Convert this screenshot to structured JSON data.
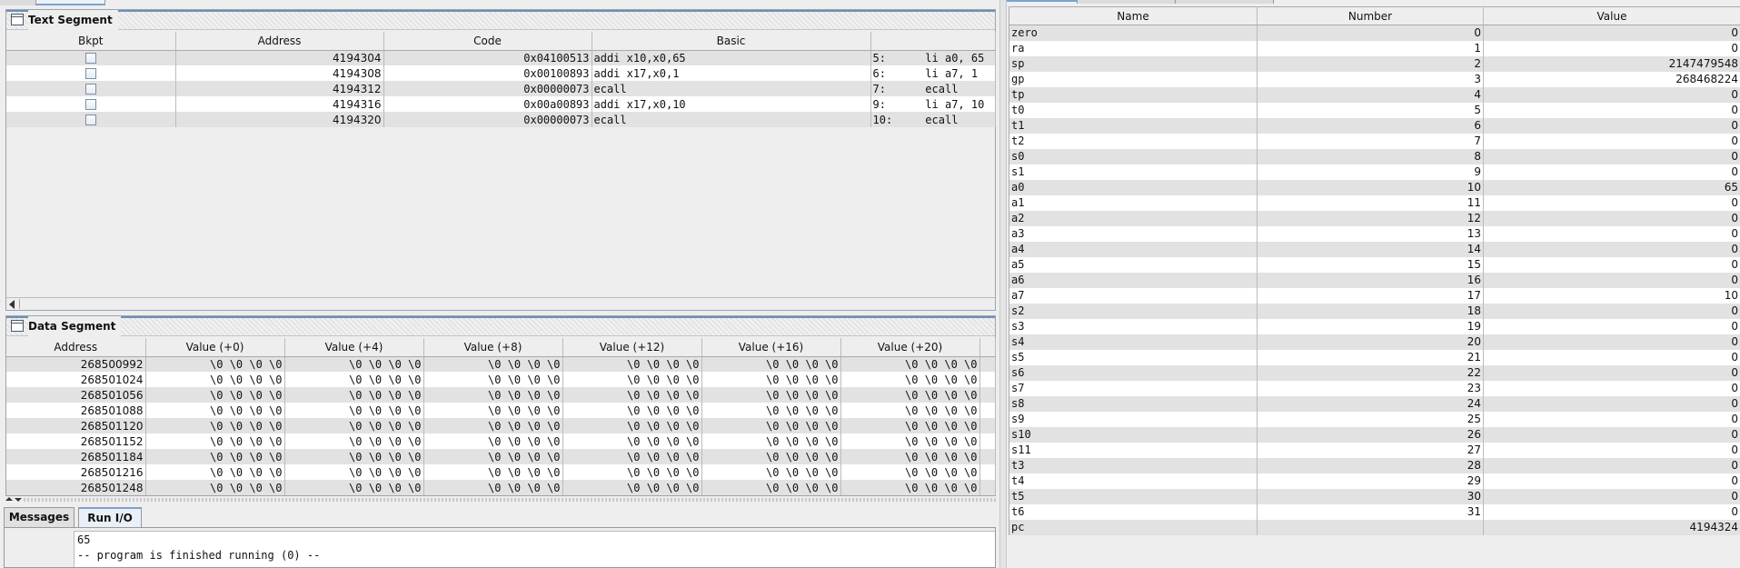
{
  "text_segment": {
    "title": "Text Segment",
    "columns": [
      "Bkpt",
      "Address",
      "Code",
      "Basic",
      ""
    ],
    "rows": [
      {
        "address": "4194304",
        "code": "0x04100513",
        "basic": "addi x10,x0,65",
        "source": "5:      li a0, 65"
      },
      {
        "address": "4194308",
        "code": "0x00100893",
        "basic": "addi x17,x0,1",
        "source": "6:      li a7, 1"
      },
      {
        "address": "4194312",
        "code": "0x00000073",
        "basic": "ecall",
        "source": "7:      ecall"
      },
      {
        "address": "4194316",
        "code": "0x00a00893",
        "basic": "addi x17,x0,10",
        "source": "9:      li a7, 10"
      },
      {
        "address": "4194320",
        "code": "0x00000073",
        "basic": "ecall",
        "source": "10:     ecall"
      }
    ]
  },
  "data_segment": {
    "title": "Data Segment",
    "columns": [
      "Address",
      "Value (+0)",
      "Value (+4)",
      "Value (+8)",
      "Value (+12)",
      "Value (+16)",
      "Value (+20)"
    ],
    "cell_value": "\\0 \\0 \\0 \\0",
    "rows": [
      {
        "address": "268500992",
        "values": [
          "\\0 \\0 \\0 \\0",
          "\\0 \\0 \\0 \\0",
          "\\0 \\0 \\0 \\0",
          "\\0 \\0 \\0 \\0",
          "\\0 \\0 \\0 \\0",
          "\\0 \\0 \\0 \\0"
        ]
      },
      {
        "address": "268501024",
        "values": [
          "\\0 \\0 \\0 \\0",
          "\\0 \\0 \\0 \\0",
          "\\0 \\0 \\0 \\0",
          "\\0 \\0 \\0 \\0",
          "\\0 \\0 \\0 \\0",
          "\\0 \\0 \\0 \\0"
        ]
      },
      {
        "address": "268501056",
        "values": [
          "\\0 \\0 \\0 \\0",
          "\\0 \\0 \\0 \\0",
          "\\0 \\0 \\0 \\0",
          "\\0 \\0 \\0 \\0",
          "\\0 \\0 \\0 \\0",
          "\\0 \\0 \\0 \\0"
        ]
      },
      {
        "address": "268501088",
        "values": [
          "\\0 \\0 \\0 \\0",
          "\\0 \\0 \\0 \\0",
          "\\0 \\0 \\0 \\0",
          "\\0 \\0 \\0 \\0",
          "\\0 \\0 \\0 \\0",
          "\\0 \\0 \\0 \\0"
        ]
      },
      {
        "address": "268501120",
        "values": [
          "\\0 \\0 \\0 \\0",
          "\\0 \\0 \\0 \\0",
          "\\0 \\0 \\0 \\0",
          "\\0 \\0 \\0 \\0",
          "\\0 \\0 \\0 \\0",
          "\\0 \\0 \\0 \\0"
        ]
      },
      {
        "address": "268501152",
        "values": [
          "\\0 \\0 \\0 \\0",
          "\\0 \\0 \\0 \\0",
          "\\0 \\0 \\0 \\0",
          "\\0 \\0 \\0 \\0",
          "\\0 \\0 \\0 \\0",
          "\\0 \\0 \\0 \\0"
        ]
      },
      {
        "address": "268501184",
        "values": [
          "\\0 \\0 \\0 \\0",
          "\\0 \\0 \\0 \\0",
          "\\0 \\0 \\0 \\0",
          "\\0 \\0 \\0 \\0",
          "\\0 \\0 \\0 \\0",
          "\\0 \\0 \\0 \\0"
        ]
      },
      {
        "address": "268501216",
        "values": [
          "\\0 \\0 \\0 \\0",
          "\\0 \\0 \\0 \\0",
          "\\0 \\0 \\0 \\0",
          "\\0 \\0 \\0 \\0",
          "\\0 \\0 \\0 \\0",
          "\\0 \\0 \\0 \\0"
        ]
      },
      {
        "address": "268501248",
        "values": [
          "\\0 \\0 \\0 \\0",
          "\\0 \\0 \\0 \\0",
          "\\0 \\0 \\0 \\0",
          "\\0 \\0 \\0 \\0",
          "\\0 \\0 \\0 \\0",
          "\\0 \\0 \\0 \\0"
        ]
      }
    ]
  },
  "bottom_tabs": [
    {
      "label": "Messages",
      "active": false
    },
    {
      "label": "Run I/O",
      "active": true
    }
  ],
  "run_io": {
    "lines": [
      "65",
      "-- program is finished running (0) --"
    ]
  },
  "registers": {
    "columns": [
      "Name",
      "Number",
      "Value"
    ],
    "rows": [
      {
        "name": "zero",
        "number": "0",
        "value": "0"
      },
      {
        "name": "ra",
        "number": "1",
        "value": "0"
      },
      {
        "name": "sp",
        "number": "2",
        "value": "2147479548"
      },
      {
        "name": "gp",
        "number": "3",
        "value": "268468224"
      },
      {
        "name": "tp",
        "number": "4",
        "value": "0"
      },
      {
        "name": "t0",
        "number": "5",
        "value": "0"
      },
      {
        "name": "t1",
        "number": "6",
        "value": "0"
      },
      {
        "name": "t2",
        "number": "7",
        "value": "0"
      },
      {
        "name": "s0",
        "number": "8",
        "value": "0"
      },
      {
        "name": "s1",
        "number": "9",
        "value": "0"
      },
      {
        "name": "a0",
        "number": "10",
        "value": "65"
      },
      {
        "name": "a1",
        "number": "11",
        "value": "0"
      },
      {
        "name": "a2",
        "number": "12",
        "value": "0"
      },
      {
        "name": "a3",
        "number": "13",
        "value": "0"
      },
      {
        "name": "a4",
        "number": "14",
        "value": "0"
      },
      {
        "name": "a5",
        "number": "15",
        "value": "0"
      },
      {
        "name": "a6",
        "number": "16",
        "value": "0"
      },
      {
        "name": "a7",
        "number": "17",
        "value": "10"
      },
      {
        "name": "s2",
        "number": "18",
        "value": "0"
      },
      {
        "name": "s3",
        "number": "19",
        "value": "0"
      },
      {
        "name": "s4",
        "number": "20",
        "value": "0"
      },
      {
        "name": "s5",
        "number": "21",
        "value": "0"
      },
      {
        "name": "s6",
        "number": "22",
        "value": "0"
      },
      {
        "name": "s7",
        "number": "23",
        "value": "0"
      },
      {
        "name": "s8",
        "number": "24",
        "value": "0"
      },
      {
        "name": "s9",
        "number": "25",
        "value": "0"
      },
      {
        "name": "s10",
        "number": "26",
        "value": "0"
      },
      {
        "name": "s11",
        "number": "27",
        "value": "0"
      },
      {
        "name": "t3",
        "number": "28",
        "value": "0"
      },
      {
        "name": "t4",
        "number": "29",
        "value": "0"
      },
      {
        "name": "t5",
        "number": "30",
        "value": "0"
      },
      {
        "name": "t6",
        "number": "31",
        "value": "0"
      },
      {
        "name": "pc",
        "number": "",
        "value": "4194324"
      }
    ]
  },
  "colors": {
    "row_alt": "#e2e2e2",
    "row_plain": "#ffffff",
    "accent": "#7da2ce"
  }
}
